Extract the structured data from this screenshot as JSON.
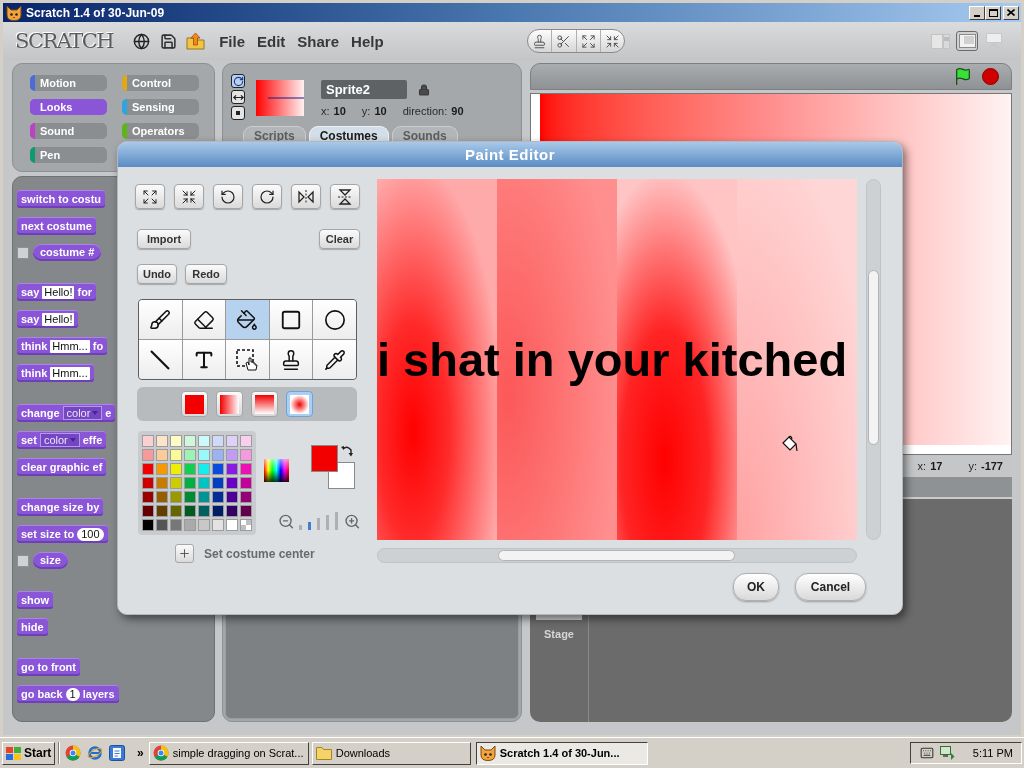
{
  "window": {
    "title": "Scratch 1.4 of 30-Jun-09"
  },
  "toolbar": {
    "logo": "SCRATCH",
    "menus": [
      "File",
      "Edit",
      "Share",
      "Help"
    ],
    "stage_modes": [
      {
        "kind": "small",
        "selected": false
      },
      {
        "kind": "normal",
        "selected": true
      },
      {
        "kind": "presentation",
        "selected": false
      }
    ]
  },
  "categories": [
    {
      "label": "Motion",
      "color": "#4a6cd4",
      "selected": false
    },
    {
      "label": "Control",
      "color": "#e1a91a",
      "selected": false
    },
    {
      "label": "Looks",
      "color": "#8a55d7",
      "selected": true
    },
    {
      "label": "Sensing",
      "color": "#2ca5e2",
      "selected": false
    },
    {
      "label": "Sound",
      "color": "#bb42c3",
      "selected": false
    },
    {
      "label": "Operators",
      "color": "#5cb712",
      "selected": false
    },
    {
      "label": "Pen",
      "color": "#0e9a6c",
      "selected": false
    }
  ],
  "palette": {
    "groups": [
      [
        {
          "kind": "command",
          "parts": [
            {
              "kind": "text",
              "text": "switch to costu"
            }
          ]
        },
        {
          "kind": "command",
          "parts": [
            {
              "kind": "text",
              "text": "next costume"
            }
          ]
        },
        {
          "kind": "reporter",
          "checked": false,
          "parts": [
            {
              "kind": "text",
              "text": "costume #"
            }
          ]
        }
      ],
      [
        {
          "kind": "command",
          "parts": [
            {
              "kind": "text",
              "text": "say"
            },
            {
              "kind": "input",
              "text": "Hello!"
            },
            {
              "kind": "text",
              "text": "for"
            }
          ]
        },
        {
          "kind": "command",
          "parts": [
            {
              "kind": "text",
              "text": "say"
            },
            {
              "kind": "input",
              "text": "Hello!"
            }
          ]
        },
        {
          "kind": "command",
          "parts": [
            {
              "kind": "text",
              "text": "think"
            },
            {
              "kind": "input",
              "text": "Hmm..."
            },
            {
              "kind": "text",
              "text": "fo"
            }
          ]
        },
        {
          "kind": "command",
          "parts": [
            {
              "kind": "text",
              "text": "think"
            },
            {
              "kind": "input",
              "text": "Hmm..."
            }
          ]
        }
      ],
      [
        {
          "kind": "command",
          "parts": [
            {
              "kind": "text",
              "text": "change"
            },
            {
              "kind": "dropdown",
              "text": "color"
            },
            {
              "kind": "text",
              "text": "e"
            }
          ]
        },
        {
          "kind": "command",
          "parts": [
            {
              "kind": "text",
              "text": "set"
            },
            {
              "kind": "dropdown",
              "text": "color"
            },
            {
              "kind": "text",
              "text": "effe"
            }
          ]
        },
        {
          "kind": "command",
          "parts": [
            {
              "kind": "text",
              "text": "clear graphic ef"
            }
          ]
        }
      ],
      [
        {
          "kind": "command",
          "parts": [
            {
              "kind": "text",
              "text": "change size by"
            }
          ]
        },
        {
          "kind": "command",
          "parts": [
            {
              "kind": "text",
              "text": "set size to"
            },
            {
              "kind": "number",
              "text": "100"
            }
          ]
        },
        {
          "kind": "reporter",
          "checked": false,
          "parts": [
            {
              "kind": "text",
              "text": "size"
            }
          ]
        }
      ],
      [
        {
          "kind": "command",
          "parts": [
            {
              "kind": "text",
              "text": "show"
            }
          ]
        },
        {
          "kind": "command",
          "parts": [
            {
              "kind": "text",
              "text": "hide"
            }
          ]
        }
      ],
      [
        {
          "kind": "command",
          "parts": [
            {
              "kind": "text",
              "text": "go to front"
            }
          ]
        },
        {
          "kind": "command",
          "parts": [
            {
              "kind": "text",
              "text": "go back"
            },
            {
              "kind": "number",
              "text": "1"
            },
            {
              "kind": "text",
              "text": "layers"
            }
          ]
        }
      ]
    ]
  },
  "sprite": {
    "rotation_styles": [
      {
        "kind": "rotate",
        "selected": true
      },
      {
        "kind": "flip",
        "selected": false
      },
      {
        "kind": "none",
        "selected": false
      }
    ],
    "name": "Sprite2",
    "coords": [
      {
        "label": "x:",
        "value": "10"
      },
      {
        "label": "y:",
        "value": "10"
      },
      {
        "label": "direction:",
        "value": "90"
      }
    ]
  },
  "tabs": [
    {
      "label": "Scripts",
      "selected": false
    },
    {
      "label": "Costumes",
      "selected": true
    },
    {
      "label": "Sounds",
      "selected": false
    }
  ],
  "stage": {
    "coords": [
      {
        "label": "x:",
        "value": "17"
      },
      {
        "label": "y:",
        "value": "-177"
      }
    ]
  },
  "sprite_list": {
    "stage_label": "Stage"
  },
  "paint_editor": {
    "title": "Paint Editor",
    "buttons": {
      "import": "Import",
      "clear": "Clear",
      "undo": "Undo",
      "redo": "Redo",
      "ok": "OK",
      "cancel": "Cancel"
    },
    "tools": [
      {
        "kind": "brush",
        "selected": false
      },
      {
        "kind": "eraser",
        "selected": false
      },
      {
        "kind": "fill",
        "selected": true
      },
      {
        "kind": "rectangle",
        "selected": false
      },
      {
        "kind": "ellipse",
        "selected": false
      },
      {
        "kind": "line",
        "selected": false
      },
      {
        "kind": "text",
        "selected": false
      },
      {
        "kind": "select",
        "selected": false
      },
      {
        "kind": "stamp",
        "selected": false
      },
      {
        "kind": "eyedropper",
        "selected": false
      }
    ],
    "fill_types": [
      {
        "kind": "solid",
        "selected": false
      },
      {
        "kind": "horizontal",
        "selected": false
      },
      {
        "kind": "vertical",
        "selected": false
      },
      {
        "kind": "radial",
        "selected": true
      }
    ],
    "swatches": [
      [
        {
          "kind": "solid",
          "color": "#fcd0d0"
        },
        {
          "kind": "solid",
          "color": "#fde4c8"
        },
        {
          "kind": "solid",
          "color": "#fdfcc4"
        },
        {
          "kind": "solid",
          "color": "#cff7dc"
        },
        {
          "kind": "solid",
          "color": "#ccfafa"
        },
        {
          "kind": "solid",
          "color": "#cfdafa"
        },
        {
          "kind": "solid",
          "color": "#e0cffa"
        },
        {
          "kind": "solid",
          "color": "#f9cff0"
        }
      ],
      [
        {
          "kind": "solid",
          "color": "#f99999"
        },
        {
          "kind": "solid",
          "color": "#fbcb99"
        },
        {
          "kind": "solid",
          "color": "#fafa99"
        },
        {
          "kind": "solid",
          "color": "#9cf3b4"
        },
        {
          "kind": "solid",
          "color": "#99f8f8"
        },
        {
          "kind": "solid",
          "color": "#9ab3f5"
        },
        {
          "kind": "solid",
          "color": "#c29bf5"
        },
        {
          "kind": "solid",
          "color": "#f39bde"
        }
      ],
      [
        {
          "kind": "solid",
          "color": "#f20000"
        },
        {
          "kind": "solid",
          "color": "#f59900"
        },
        {
          "kind": "solid",
          "color": "#eeee00"
        },
        {
          "kind": "solid",
          "color": "#14cf4f"
        },
        {
          "kind": "solid",
          "color": "#14eeee"
        },
        {
          "kind": "solid",
          "color": "#0a4be0"
        },
        {
          "kind": "solid",
          "color": "#8a1be6"
        },
        {
          "kind": "solid",
          "color": "#ee0fb7"
        }
      ],
      [
        {
          "kind": "solid",
          "color": "#cc0000"
        },
        {
          "kind": "solid",
          "color": "#c97a00"
        },
        {
          "kind": "solid",
          "color": "#cccc00"
        },
        {
          "kind": "solid",
          "color": "#00b040"
        },
        {
          "kind": "solid",
          "color": "#00c4c4"
        },
        {
          "kind": "solid",
          "color": "#0040c0"
        },
        {
          "kind": "solid",
          "color": "#6a00c8"
        },
        {
          "kind": "solid",
          "color": "#c4009a"
        }
      ],
      [
        {
          "kind": "solid",
          "color": "#990000"
        },
        {
          "kind": "solid",
          "color": "#955e00"
        },
        {
          "kind": "solid",
          "color": "#999900"
        },
        {
          "kind": "solid",
          "color": "#008a34"
        },
        {
          "kind": "solid",
          "color": "#009494"
        },
        {
          "kind": "solid",
          "color": "#002f98"
        },
        {
          "kind": "solid",
          "color": "#4f0098"
        },
        {
          "kind": "solid",
          "color": "#940076"
        }
      ],
      [
        {
          "kind": "solid",
          "color": "#660000"
        },
        {
          "kind": "solid",
          "color": "#633e00"
        },
        {
          "kind": "solid",
          "color": "#666600"
        },
        {
          "kind": "solid",
          "color": "#005a22"
        },
        {
          "kind": "solid",
          "color": "#005f5f"
        },
        {
          "kind": "solid",
          "color": "#001e66"
        },
        {
          "kind": "solid",
          "color": "#330066"
        },
        {
          "kind": "solid",
          "color": "#63004e"
        }
      ],
      [
        {
          "kind": "solid",
          "color": "#000000"
        },
        {
          "kind": "solid",
          "color": "#555555"
        },
        {
          "kind": "solid",
          "color": "#777777"
        },
        {
          "kind": "solid",
          "color": "#aaaaaa"
        },
        {
          "kind": "solid",
          "color": "#c8c8c8"
        },
        {
          "kind": "solid",
          "color": "#e3e3e3"
        },
        {
          "kind": "solid",
          "color": "#ffffff"
        },
        {
          "kind": "transparent"
        }
      ]
    ],
    "foreground": {
      "color": "#f20000"
    },
    "background": {
      "color": "#ffffff"
    },
    "zoom_steps": [
      {
        "selected": false
      },
      {
        "selected": true
      },
      {
        "selected": false
      },
      {
        "selected": false
      },
      {
        "selected": false
      }
    ],
    "set_center": "Set costume center",
    "canvas_text": "i shat in your kitched"
  },
  "taskbar": {
    "start": "Start",
    "more": "»",
    "tasks": [
      {
        "kind": "browser",
        "label": "simple dragging on Scrat...",
        "selected": false
      },
      {
        "kind": "folder",
        "label": "Downloads",
        "selected": false
      },
      {
        "kind": "app",
        "label": "Scratch 1.4 of 30-Jun...",
        "selected": true
      }
    ],
    "clock": "5:11 PM"
  }
}
